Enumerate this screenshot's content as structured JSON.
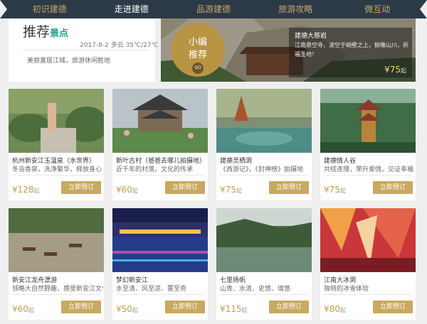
{
  "nav": [
    "初识建德",
    "走进建德",
    "品游建德",
    "旅游攻略",
    "微互动"
  ],
  "today": {
    "title": "推荐",
    "accent": "景点",
    "meta": "2017-8-2  多云  35℃/27℃",
    "desc": "美丽富居江城，旅游休闲胜地"
  },
  "feature": {
    "badge_l1": "小编",
    "badge_l2": "推荐",
    "badge_go": "GO",
    "name": "建德大慈岩",
    "desc": "江南悬空寺，凌空于峭壁之上，俯瞰山川，祈福圣地！",
    "price_symbol": "¥",
    "price": "75",
    "price_unit": "起"
  },
  "cards": [
    {
      "title": "杭州新安江玉温泉（水世界）",
      "desc": "冬浴香泉，洗净繁华，释放身心",
      "price_symbol": "¥",
      "price": "128",
      "price_unit": "起",
      "button": "立即预订"
    },
    {
      "title": "新叶古村（爸爸去哪儿拍摄地）",
      "desc": "近千年的村落，文化的传承",
      "price_symbol": "¥",
      "price": "60",
      "price_unit": "起",
      "button": "立即预订"
    },
    {
      "title": "建德灵栖洞",
      "desc": "《西游记》，《封神榜》拍摄地",
      "price_symbol": "¥",
      "price": "75",
      "price_unit": "起",
      "button": "立即预订"
    },
    {
      "title": "建德情人谷",
      "desc": "共结连理，荣升爱情，见证幸福",
      "price_symbol": "¥",
      "price": "75",
      "price_unit": "起",
      "button": "立即预订"
    },
    {
      "title": "新安江龙舟漂游",
      "desc": "领略大自然野趣，感受新安江文化",
      "price_symbol": "¥",
      "price": "60",
      "price_unit": "起",
      "button": "立即预订"
    },
    {
      "title": "梦幻新安江",
      "desc": "水至清、风至凉、雾至奇",
      "price_symbol": "¥",
      "price": "50",
      "price_unit": "起",
      "button": "立即预订"
    },
    {
      "title": "七里扬帆",
      "desc": "山青、水清、史悠、境悠",
      "price_symbol": "¥",
      "price": "115",
      "price_unit": "起",
      "button": "立即预订"
    },
    {
      "title": "江南大冰洞",
      "desc": "独特的冰雪体验",
      "price_symbol": "¥",
      "price": "80",
      "price_unit": "起",
      "button": "立即预订"
    }
  ]
}
